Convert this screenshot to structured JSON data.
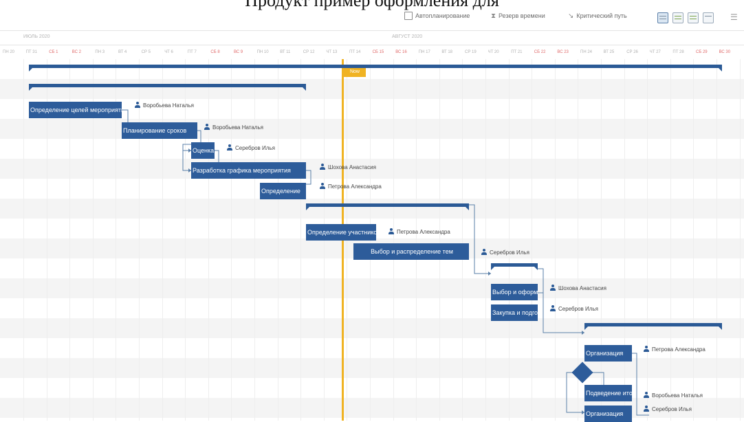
{
  "caption": "Продукт пример оформления для",
  "toolbar": {
    "auto_scheduling": "Автопланирование",
    "time_reserve": "Резерв времени",
    "critical_path": "Критический путь"
  },
  "timeline": {
    "months": [
      "ИЮЛЬ 2020",
      "АВГУСТ 2020"
    ],
    "days": [
      {
        "label": "ПН 20",
        "weekend": false
      },
      {
        "label": "ПТ 31",
        "weekend": false
      },
      {
        "label": "СБ 1",
        "weekend": true
      },
      {
        "label": "ВС 2",
        "weekend": true
      },
      {
        "label": "ПН 3",
        "weekend": false
      },
      {
        "label": "ВТ 4",
        "weekend": false
      },
      {
        "label": "СР 5",
        "weekend": false
      },
      {
        "label": "ЧТ 6",
        "weekend": false
      },
      {
        "label": "ПТ 7",
        "weekend": false
      },
      {
        "label": "СБ 8",
        "weekend": true
      },
      {
        "label": "ВС 9",
        "weekend": true
      },
      {
        "label": "ПН 10",
        "weekend": false
      },
      {
        "label": "ВТ 11",
        "weekend": false
      },
      {
        "label": "СР 12",
        "weekend": false
      },
      {
        "label": "ЧТ 13",
        "weekend": false
      },
      {
        "label": "ПТ 14",
        "weekend": false
      },
      {
        "label": "СБ 15",
        "weekend": true
      },
      {
        "label": "ВС 16",
        "weekend": true
      },
      {
        "label": "ПН 17",
        "weekend": false
      },
      {
        "label": "ВТ 18",
        "weekend": false
      },
      {
        "label": "СР 19",
        "weekend": false
      },
      {
        "label": "ЧТ 20",
        "weekend": false
      },
      {
        "label": "ПТ 21",
        "weekend": false
      },
      {
        "label": "СБ 22",
        "weekend": true
      },
      {
        "label": "ВС 23",
        "weekend": true
      },
      {
        "label": "ПН 24",
        "weekend": false
      },
      {
        "label": "ВТ 25",
        "weekend": false
      },
      {
        "label": "СР 26",
        "weekend": false
      },
      {
        "label": "ЧТ 27",
        "weekend": false
      },
      {
        "label": "ПТ 28",
        "weekend": false
      },
      {
        "label": "СБ 29",
        "weekend": true
      },
      {
        "label": "ВС 30",
        "weekend": true
      }
    ],
    "today_label": "Now"
  },
  "tasks": {
    "t1": {
      "label": "Определение целей мероприятия",
      "resource": "Воробьева Наталья"
    },
    "t2": {
      "label": "Планирование сроков",
      "resource": "Воробьева Наталья"
    },
    "t3": {
      "label": "Оценка",
      "resource": "Серебров Илья"
    },
    "t4": {
      "label": "Разработка графика мероприятия",
      "resource": "Шохова Анастасия"
    },
    "t5": {
      "label": "Определение",
      "resource": "Петрова Александра"
    },
    "t6": {
      "label": "Определение участников",
      "resource": "Петрова Александра"
    },
    "t7": {
      "label": "Выбор и распределение тем",
      "resource": "Серебров Илья"
    },
    "t8": {
      "label": "Выбор и оформление",
      "resource": "Шохова Анастасия"
    },
    "t9": {
      "label": "Закупка и подготовка",
      "resource": "Серебров Илья"
    },
    "t10": {
      "label": "Организация",
      "resource": "Петрова Александра"
    },
    "t11": {
      "label": "Подведение итогов",
      "resource": "Воробьева Наталья"
    },
    "t12": {
      "label": "Организация",
      "resource": "Серебров Илья"
    }
  },
  "colors": {
    "task": "#2d5c9a",
    "today": "#f0b323",
    "weekend": "#e06a6a"
  }
}
